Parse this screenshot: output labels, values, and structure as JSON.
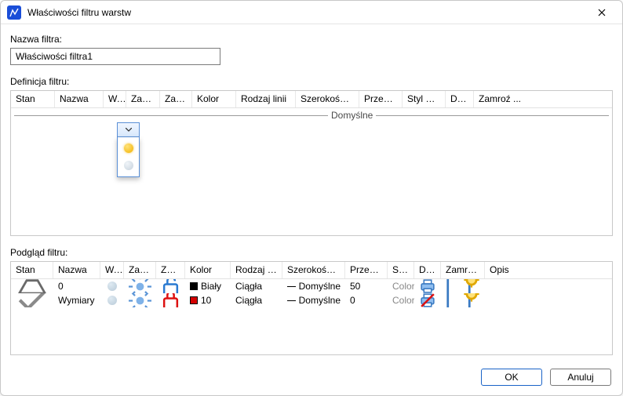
{
  "window": {
    "title": "Właściwości filtru warstw"
  },
  "labels": {
    "filter_name": "Nazwa filtra:",
    "filter_def": "Definicja filtru:",
    "filter_preview": "Podgląd filtru:"
  },
  "inputs": {
    "filter_name_value": "Właściwości filtra1"
  },
  "def_columns": [
    "Stan",
    "Nazwa",
    "W..",
    "Zamr...",
    "Zabl...",
    "Kolor",
    "Rodzaj linii",
    "Szerokość linii",
    "Przeźro...",
    "Styl wyd...",
    "Dru...",
    "Zamroź ..."
  ],
  "def_dropdown": {
    "value": "",
    "options_semantic": [
      "visible-on",
      "visible-off"
    ]
  },
  "def_group_label": "Domyślne",
  "prev_columns": [
    "Stan",
    "Nazwa",
    "W...",
    "Zamr...",
    "Zabl...",
    "Kolor",
    "Rodzaj linii",
    "Szerokość linii",
    "Przeźro...",
    "Styl...",
    "Dru...",
    "Zamroź ...",
    "Opis"
  ],
  "prev_rows": [
    {
      "stan": "current",
      "name": "0",
      "visible": "on",
      "frozen": "no",
      "locked": "no",
      "color_hex": "#000000",
      "color_name": "Biały",
      "linetype": "Ciągła",
      "lineweight": "Domyślne",
      "transparency": "50",
      "plotstyle": "Color...",
      "print": "yes",
      "newvp": "thaw",
      "desc": ""
    },
    {
      "stan": "used",
      "name": "Wymiary",
      "visible": "on",
      "frozen": "no",
      "locked": "yes",
      "color_hex": "#d40000",
      "color_name": "10",
      "linetype": "Ciągła",
      "lineweight": "Domyślne",
      "transparency": "0",
      "plotstyle": "Color...",
      "print": "no",
      "newvp": "thaw",
      "desc": ""
    }
  ],
  "buttons": {
    "ok": "OK",
    "cancel": "Anuluj"
  }
}
